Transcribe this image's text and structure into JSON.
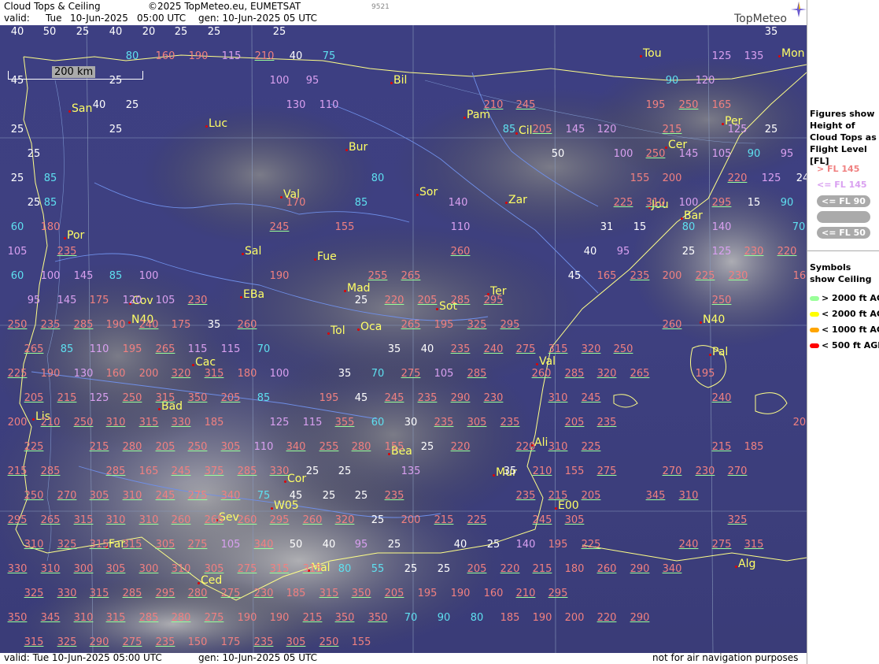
{
  "header": {
    "title": "Cloud Tops & Ceiling",
    "copyright": "©2025 TopMeteo.eu, EUMETSAT",
    "valid_label": "valid:",
    "valid_day": "Tue",
    "valid_date": "10-Jun-2025",
    "valid_time": "05:00 UTC",
    "gen_text": "gen: 10-Jun-2025 05 UTC",
    "code": "9521",
    "brand": "TopMeteo"
  },
  "footer": {
    "valid_text": "valid:  Tue  10-Jun-2025  05:00 UTC",
    "gen_text": "gen: 10-Jun-2025 05 UTC",
    "disclaimer": "not for air navigation purposes"
  },
  "scale": {
    "label": "200 km"
  },
  "legend": {
    "figures_title": "Figures show Height of Cloud Tops as Flight Level [FL]",
    "fl_items": [
      {
        "text": "> FL 145",
        "color": "#f08080"
      },
      {
        "text": "<= FL 145",
        "color": "#d9a0f0"
      },
      {
        "text": "<= FL 90",
        "color": "#ffffff"
      },
      {
        "text": "<= FL 70",
        "color": "#aaaaaa"
      },
      {
        "text": "<= FL 50",
        "color": "#ffffff"
      }
    ],
    "symbols_title": "Symbols show Ceiling",
    "ceiling_items": [
      {
        "text": "> 2000 ft AGL",
        "color": "#99ff99"
      },
      {
        "text": "< 2000 ft AGL",
        "color": "#ffff00"
      },
      {
        "text": "< 1000 ft AGL",
        "color": "#ffa500"
      },
      {
        "text": "< 500 ft AGL",
        "color": "#ff0000"
      }
    ]
  },
  "cities": [
    {
      "name": "Tou"
    },
    {
      "name": "Mon"
    },
    {
      "name": "Bil"
    },
    {
      "name": "San"
    },
    {
      "name": "Luc"
    },
    {
      "name": "Pam"
    },
    {
      "name": "Cil"
    },
    {
      "name": "Per"
    },
    {
      "name": "Cer"
    },
    {
      "name": "Bur"
    },
    {
      "name": "Sor"
    },
    {
      "name": "Zar"
    },
    {
      "name": "Val"
    },
    {
      "name": "Jou"
    },
    {
      "name": "Bar"
    },
    {
      "name": "Por"
    },
    {
      "name": "Sal"
    },
    {
      "name": "Fue"
    },
    {
      "name": "Mad"
    },
    {
      "name": "Ter"
    },
    {
      "name": "Cov"
    },
    {
      "name": "EBa"
    },
    {
      "name": "Sot"
    },
    {
      "name": "Tol"
    },
    {
      "name": "Oca"
    },
    {
      "name": "Pal"
    },
    {
      "name": "Cac"
    },
    {
      "name": "Val"
    },
    {
      "name": "Lis"
    },
    {
      "name": "Bad"
    },
    {
      "name": "Ali"
    },
    {
      "name": "Bea"
    },
    {
      "name": "Mur"
    },
    {
      "name": "Cor"
    },
    {
      "name": "Sev"
    },
    {
      "name": "Far"
    },
    {
      "name": "Mal"
    },
    {
      "name": "Ced"
    },
    {
      "name": "Alg"
    },
    {
      "name": "N40"
    },
    {
      "name": "N40"
    },
    {
      "name": "W05"
    },
    {
      "name": "E00"
    }
  ],
  "values": [
    "40",
    "50",
    "25",
    "40",
    "20",
    "25",
    "25",
    "25",
    "35",
    "80",
    "160",
    "190",
    "115",
    "210",
    "40",
    "75",
    "125",
    "135",
    "45",
    "25",
    "100",
    "95",
    "90",
    "120",
    "40",
    "25",
    "130",
    "110",
    "210",
    "245",
    "195",
    "250",
    "165",
    "25",
    "25",
    "85",
    "205",
    "145",
    "120",
    "215",
    "125",
    "25",
    "25",
    "50",
    "100",
    "250",
    "145",
    "105",
    "90",
    "95",
    "25",
    "85",
    "80",
    "155",
    "200",
    "220",
    "125",
    "24",
    "25",
    "85",
    "170",
    "85",
    "140",
    "225",
    "310",
    "100",
    "295",
    "15",
    "90",
    "60",
    "180",
    "245",
    "155",
    "110",
    "31",
    "15",
    "80",
    "140",
    "70",
    "105",
    "235",
    "260",
    "40",
    "95",
    "25",
    "125",
    "230",
    "220",
    "60",
    "100",
    "145",
    "85",
    "100",
    "190",
    "255",
    "265",
    "45",
    "165",
    "235",
    "200",
    "225",
    "230",
    "165",
    "95",
    "145",
    "175",
    "120",
    "105",
    "230",
    "25",
    "220",
    "205",
    "285",
    "295",
    "250",
    "250",
    "235",
    "285",
    "190",
    "240",
    "175",
    "35",
    "260",
    "265",
    "195",
    "325",
    "295",
    "260",
    "265",
    "85",
    "110",
    "195",
    "265",
    "115",
    "115",
    "70",
    "35",
    "40",
    "235",
    "240",
    "275",
    "315",
    "320",
    "250",
    "225",
    "190",
    "130",
    "160",
    "200",
    "320",
    "315",
    "180",
    "100",
    "35",
    "70",
    "275",
    "105",
    "285",
    "260",
    "285",
    "320",
    "265",
    "195",
    "205",
    "215",
    "125",
    "250",
    "315",
    "350",
    "205",
    "85",
    "195",
    "45",
    "245",
    "235",
    "290",
    "230",
    "310",
    "245",
    "240",
    "200",
    "210",
    "250",
    "310",
    "315",
    "330",
    "185",
    "125",
    "115",
    "355",
    "60",
    "30",
    "235",
    "305",
    "235",
    "205",
    "235",
    "200",
    "225",
    "215",
    "280",
    "205",
    "250",
    "305",
    "110",
    "340",
    "255",
    "280",
    "155",
    "25",
    "220",
    "220",
    "310",
    "225",
    "215",
    "185",
    "215",
    "285",
    "285",
    "165",
    "245",
    "375",
    "285",
    "330",
    "25",
    "25",
    "135",
    "35",
    "210",
    "155",
    "275",
    "270",
    "230",
    "270",
    "250",
    "270",
    "305",
    "310",
    "245",
    "275",
    "340",
    "75",
    "45",
    "25",
    "25",
    "235",
    "235",
    "215",
    "205",
    "345",
    "310",
    "295",
    "265",
    "315",
    "310",
    "310",
    "260",
    "265",
    "260",
    "295",
    "260",
    "320",
    "25",
    "200",
    "215",
    "225",
    "245",
    "305",
    "325",
    "310",
    "325",
    "315",
    "315",
    "305",
    "275",
    "105",
    "340",
    "50",
    "40",
    "95",
    "25",
    "40",
    "25",
    "140",
    "195",
    "225",
    "240",
    "275",
    "315",
    "330",
    "310",
    "300",
    "305",
    "300",
    "310",
    "305",
    "275",
    "315",
    "315",
    "80",
    "55",
    "25",
    "25",
    "205",
    "220",
    "215",
    "180",
    "260",
    "290",
    "340",
    "325",
    "330",
    "315",
    "285",
    "295",
    "280",
    "275",
    "230",
    "185",
    "315",
    "350",
    "205",
    "195",
    "190",
    "160",
    "210",
    "295",
    "350",
    "345",
    "310",
    "315",
    "285",
    "280",
    "275",
    "190",
    "190",
    "215",
    "350",
    "350",
    "70",
    "90",
    "80",
    "185",
    "190",
    "200",
    "220",
    "290",
    "315",
    "325",
    "290",
    "275",
    "235",
    "150",
    "175",
    "235",
    "305",
    "250",
    "155"
  ]
}
